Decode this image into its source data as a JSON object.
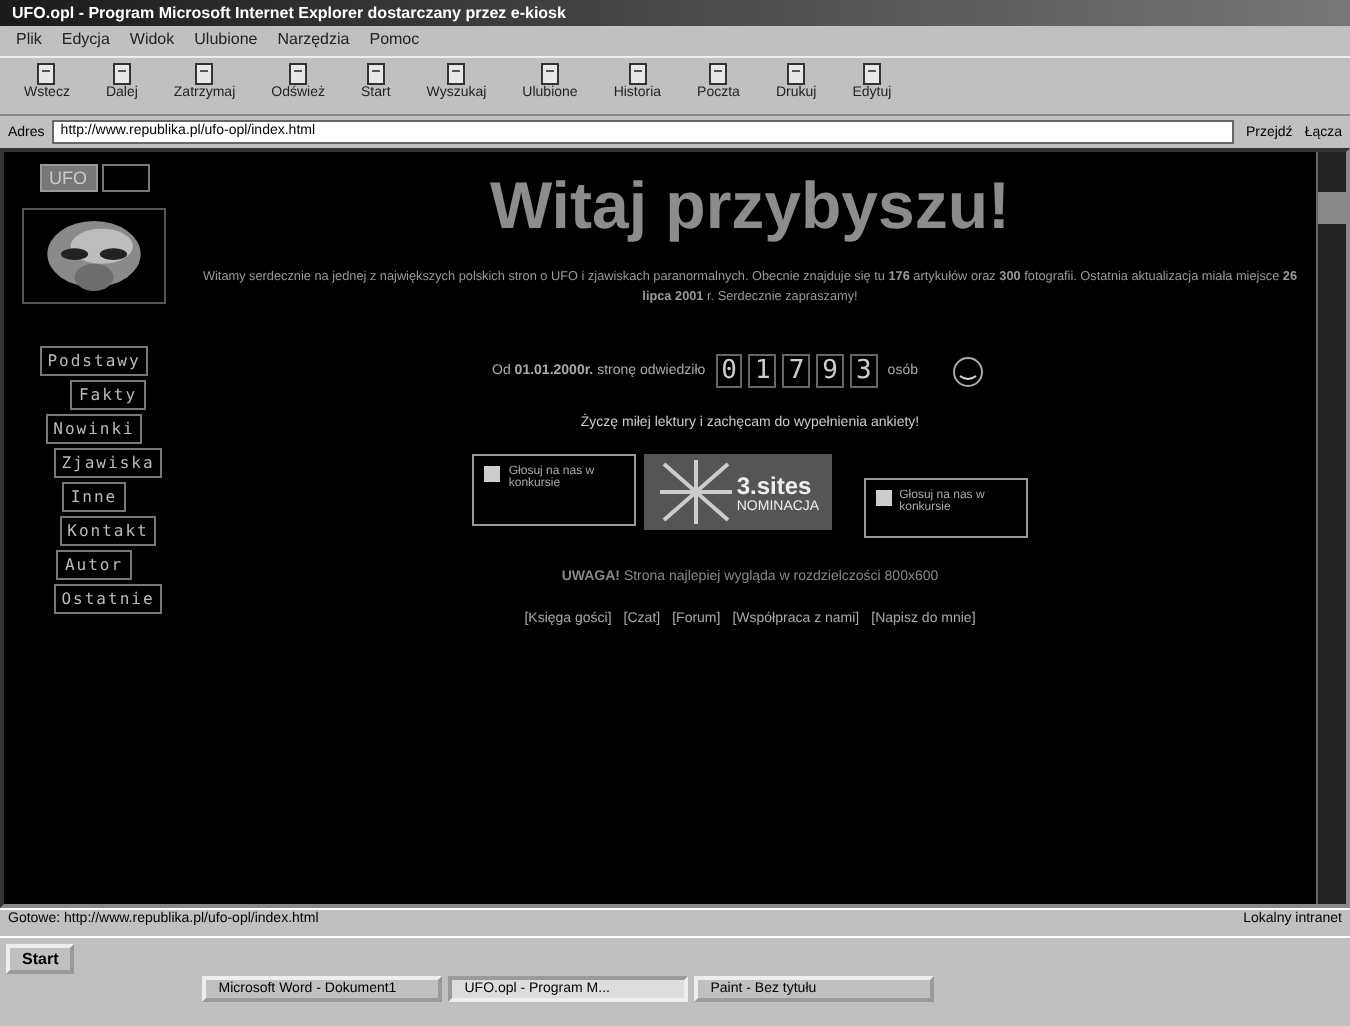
{
  "window": {
    "title": "UFO.opl - Program Microsoft Internet Explorer dostarczany przez e-kiosk"
  },
  "menu": [
    "Plik",
    "Edycja",
    "Widok",
    "Ulubione",
    "Narzędzia",
    "Pomoc"
  ],
  "toolbar": [
    "Wstecz",
    "Dalej",
    "Zatrzymaj",
    "Odśwież",
    "Start",
    "Wyszukaj",
    "Ulubione",
    "Historia",
    "Poczta",
    "Drukuj",
    "Edytuj"
  ],
  "address": {
    "label": "Adres",
    "value": "http://www.republika.pl/ufo-opl/index.html",
    "go": "Przejdź",
    "links": "Łącza"
  },
  "sidebar": {
    "logo": "UFO",
    "items": [
      "Podstawy",
      "Fakty",
      "Nowinki",
      "Zjawiska",
      "Inne",
      "Kontakt",
      "Autor",
      "Ostatnie"
    ]
  },
  "page": {
    "title": "Witaj przybyszu!",
    "intro": "Witamy serdecznie na jednej z największych polskich stron o UFO i zjawiskach paranormalnych. Obecnie znajduje się tu **176** artykułów oraz **300** fotografii. Ostatnia aktualizacja miała miejsce **26 lipca 2001** r. Serdecznie zapraszamy!",
    "counter_prefix": "Od **01.01.2000r.** stronę odwiedziło",
    "counter_digits": [
      "0",
      "1",
      "7",
      "9",
      "3"
    ],
    "counter_suffix": "osób",
    "greeting": "Życzę miłej lektury i zachęcam do wypełnienia ankiety!",
    "banners": [
      {
        "kind": "vote",
        "text": "Głosuj na nas w konkursie"
      },
      {
        "kind": "award",
        "title": "3.sites",
        "subtitle": "NOMINACJA"
      },
      {
        "kind": "vote",
        "text": "Głosuj na nas w konkursie"
      }
    ],
    "notice": "**UWAGA!** Strona najlepiej wygląda w rozdzielczości 800x600",
    "links": [
      "[Księga gości]",
      "[Czat]",
      "[Forum]",
      "[Współpraca z nami]",
      "[Napisz do mnie]"
    ]
  },
  "status_bar": {
    "text": "Gotowe: http://www.republika.pl/ufo-opl/index.html",
    "zone": "Lokalny intranet"
  },
  "taskbar": {
    "start": "Start",
    "tasks": [
      "Microsoft Word - Dokument1",
      "UFO.opl - Program M...",
      "Paint - Bez tytułu"
    ]
  }
}
